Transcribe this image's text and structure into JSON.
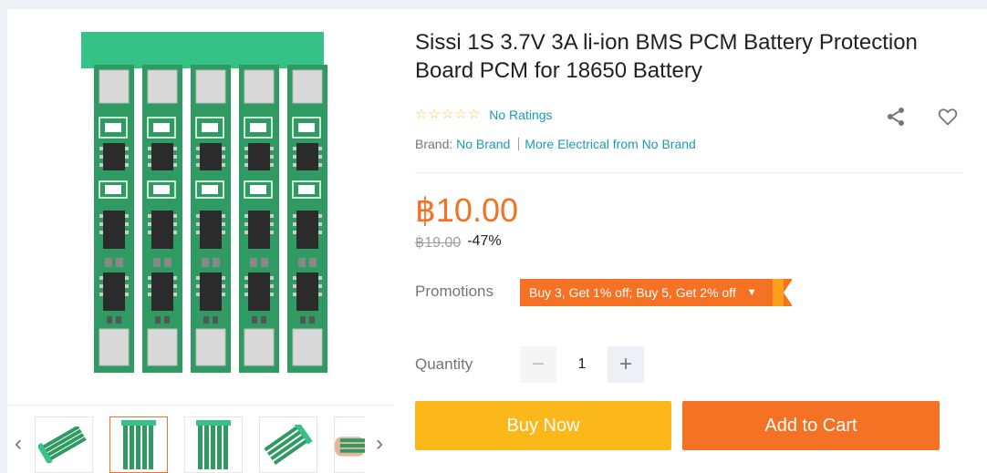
{
  "product": {
    "title": "Sissi 1S 3.7V 3A li-ion BMS PCM Battery Protection Board PCM for 18650 Battery",
    "ratings_text": "No Ratings",
    "stars": 5,
    "brand_label": "Brand:",
    "brand_name": "No Brand",
    "more_from": "More Electrical from No Brand",
    "price": "฿10.00",
    "original_price": "฿19.00",
    "discount": "-47%"
  },
  "promotions": {
    "label": "Promotions",
    "text": "Buy 3, Get 1% off; Buy 5, Get 2% off"
  },
  "quantity": {
    "label": "Quantity",
    "value": "1",
    "minus": "−",
    "plus": "+"
  },
  "actions": {
    "buy_now": "Buy Now",
    "add_to_cart": "Add to Cart"
  },
  "gallery": {
    "prev": "‹",
    "next": "›",
    "thumbnail_count": 5,
    "active_thumbnail": 2
  },
  "icons": {
    "share": "share-icon",
    "wishlist": "heart-icon",
    "star": "star-outline-icon"
  },
  "colors": {
    "accent": "#f57224",
    "buy_now": "#fcb71b",
    "link": "#1a9cb7",
    "pcb_green": "#2f9a62",
    "star": "#faca51"
  }
}
